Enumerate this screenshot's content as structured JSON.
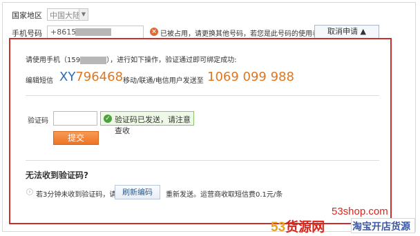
{
  "form": {
    "region_label": "国家地区",
    "region_value": "中国大陆",
    "phone_label": "手机号码",
    "phone_prefix": "+86159",
    "phone_error": "已被占用，请更换其他号码，若您是此号码的使用者",
    "cancel_button": "取消申请 ▲"
  },
  "verify_panel": {
    "instruction": "请使用手机（159",
    "instruction_tail": "），进行如下操作，验证通过即可绑定成功:",
    "sms_label": "编辑短信",
    "sms_code_prefix": "XY",
    "sms_code_number": "796468",
    "carrier_text": "移动/联通/电信用户发送至",
    "target_number": "1069 099 988",
    "code_label": "验证码",
    "code_value": "",
    "sent_tip": "验证码已发送，请注意查收",
    "submit_button": "提交",
    "no_code_title": "无法收到验证码?",
    "help_prefix": "若3分钟未收到验证码，请",
    "resend_button": "刷新编码",
    "help_suffix": "重新发送。运营商收取短信费0.1元/条"
  },
  "watermark": {
    "site": "53shop.com",
    "brand_digits": "53",
    "brand_name": "货源网",
    "slogan": "淘宝开店货源"
  },
  "colors": {
    "accent_blue": "#2a6db5",
    "accent_orange": "#e0761e",
    "error_orange": "#e06a37",
    "success_green": "#4aa33a",
    "highlight_border": "#c9302c"
  }
}
